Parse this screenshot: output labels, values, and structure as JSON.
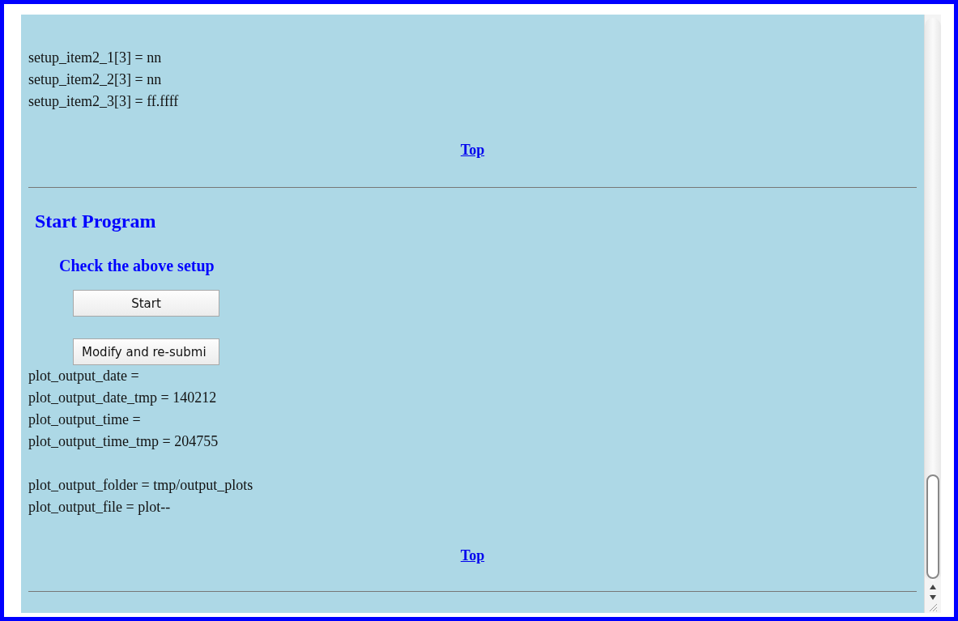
{
  "sections": [
    {
      "line_groups": [
        [
          "setup_item2_1[3] = nn",
          "setup_item2_2[3] = nn",
          "setup_item2_3[3] = ff.ffff"
        ]
      ],
      "top_link": "Top"
    },
    {
      "heading": "Start Program",
      "subheading": "Check the above setup",
      "buttons": [
        "Start",
        "Modify and re-submi"
      ],
      "line_groups": [
        [
          "plot_output_date =",
          "plot_output_date_tmp = 140212",
          "plot_output_time =",
          "plot_output_time_tmp = 204755"
        ],
        [
          "plot_output_folder = tmp/output_plots",
          "plot_output_file = plot--"
        ]
      ],
      "top_link": "Top"
    }
  ]
}
